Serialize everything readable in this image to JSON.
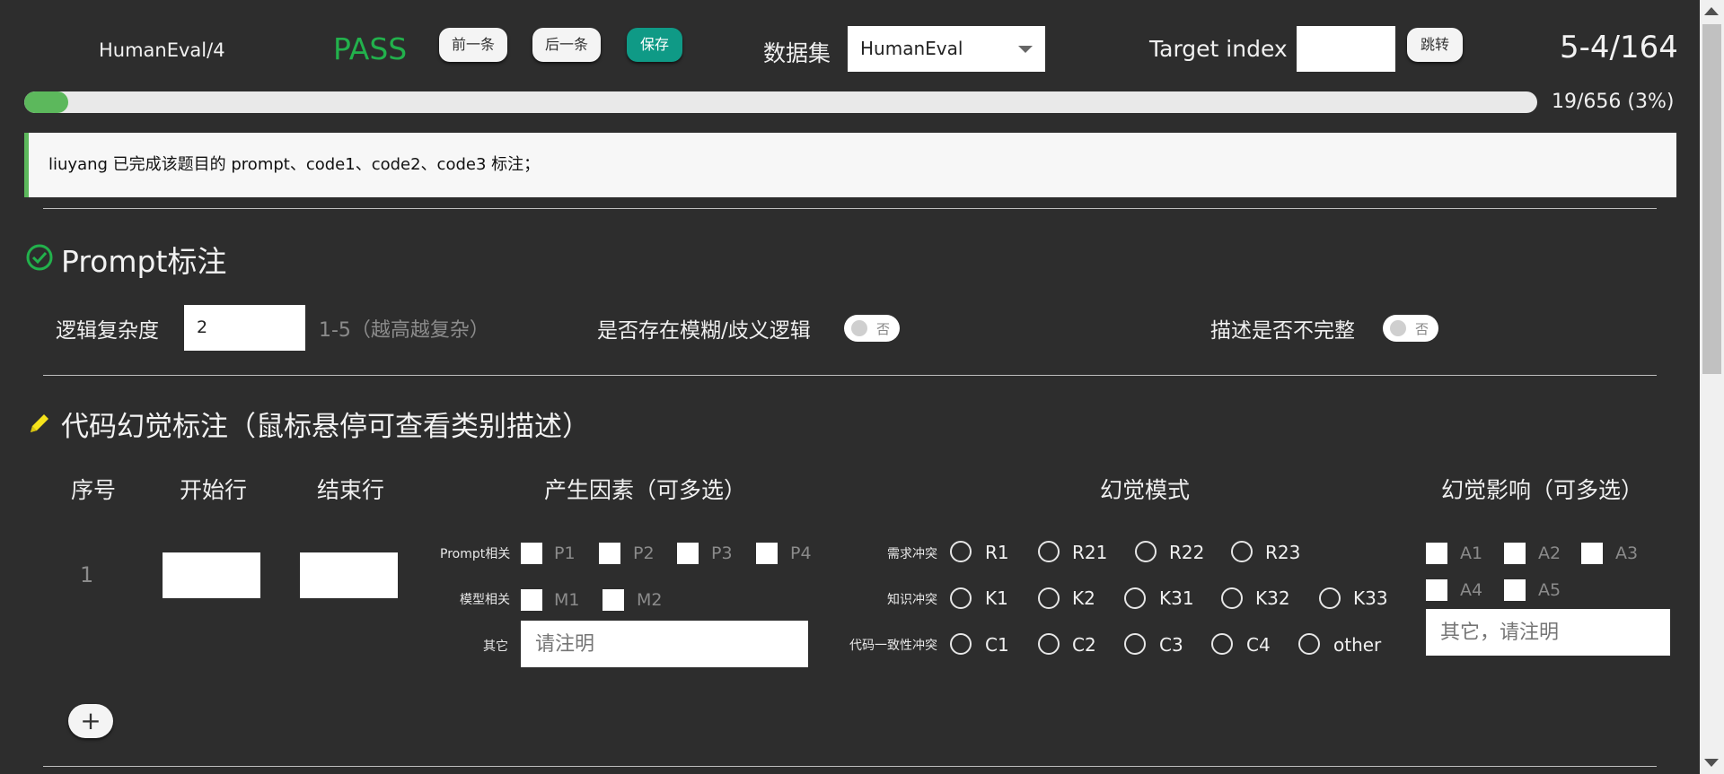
{
  "header": {
    "task_name": "HumanEval/4",
    "status": "PASS",
    "prev_label": "前一条",
    "next_label": "后一条",
    "save_label": "保存",
    "dataset_label": "数据集",
    "dataset_value": "HumanEval",
    "target_label": "Target index",
    "jump_label": "跳转",
    "counter": "5-4/164"
  },
  "progress": {
    "text": "19/656 (3%)",
    "fraction": 0.029
  },
  "notice": "liuyang 已完成该题目的 prompt、code1、code2、code3 标注；",
  "prompt_section": {
    "title": "Prompt标注",
    "complexity_label": "逻辑复杂度",
    "complexity_value": "2",
    "complexity_hint": "1-5（越高越复杂）",
    "ambiguity_label": "是否存在模糊/歧义逻辑",
    "ambiguity_toggle": "否",
    "incomplete_label": "描述是否不完整",
    "incomplete_toggle": "否"
  },
  "hallucination_section": {
    "title": "代码幻觉标注（鼠标悬停可查看类别描述）",
    "columns": [
      "序号",
      "开始行",
      "结束行",
      "产生因素（可多选）",
      "幻觉模式",
      "幻觉影响（可多选）"
    ],
    "row_index": "1",
    "factors": {
      "prompt_label": "Prompt相关",
      "prompt_options": [
        "P1",
        "P2",
        "P3",
        "P4"
      ],
      "model_label": "模型相关",
      "model_options": [
        "M1",
        "M2"
      ],
      "other_label": "其它",
      "other_placeholder": "请注明"
    },
    "modes": {
      "req_label": "需求冲突",
      "req_options": [
        "R1",
        "R21",
        "R22",
        "R23"
      ],
      "know_label": "知识冲突",
      "know_options": [
        "K1",
        "K2",
        "K31",
        "K32",
        "K33"
      ],
      "code_label": "代码一致性冲突",
      "code_options": [
        "C1",
        "C2",
        "C3",
        "C4",
        "other"
      ]
    },
    "impacts": {
      "options": [
        "A1",
        "A2",
        "A3",
        "A4",
        "A5"
      ],
      "other_placeholder": "其它，请注明"
    },
    "add_label": "+"
  }
}
